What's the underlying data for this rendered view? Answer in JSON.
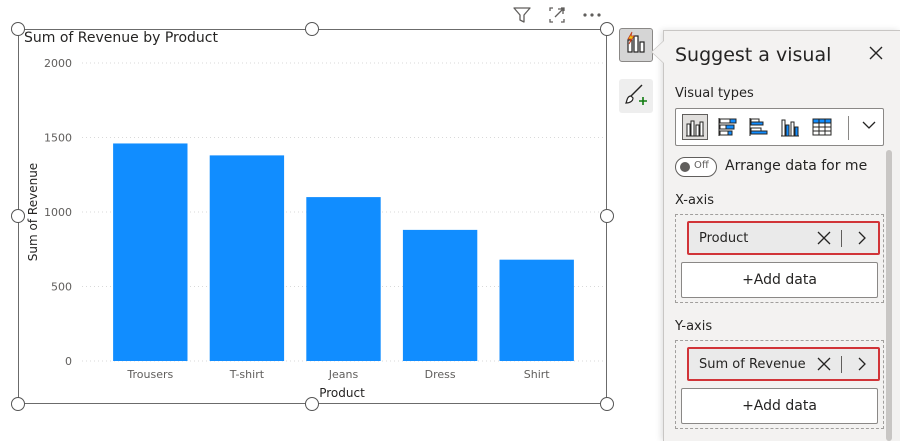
{
  "visual": {
    "header_icons": [
      "filter-icon",
      "focus-mode-icon",
      "more-options-icon"
    ]
  },
  "chart_data": {
    "type": "bar",
    "title": "Sum of Revenue by Product",
    "xlabel": "Product",
    "ylabel": "Sum of Revenue",
    "categories": [
      "Trousers",
      "T-shirt",
      "Jeans",
      "Dress",
      "Shirt"
    ],
    "values": [
      1460,
      1380,
      1100,
      880,
      680
    ],
    "ylim": [
      0,
      2000
    ],
    "yticks": [
      "0",
      "500",
      "1000",
      "1500",
      "2000"
    ],
    "bar_color": "#118dff",
    "grid": true
  },
  "ribbon": {
    "buttons": [
      "build-visual-icon",
      "format-visual-icon"
    ]
  },
  "pane": {
    "title": "Suggest a visual",
    "visual_types_label": "Visual types",
    "visual_type_icons": [
      "clustered-column-icon",
      "stacked-bar-icon",
      "clustered-bar-icon",
      "stacked-column-icon",
      "table-icon"
    ],
    "toggle_state": "Off",
    "toggle_label": "Arrange data for me",
    "x_axis": {
      "label": "X-axis",
      "field": "Product",
      "add_label": "+Add data"
    },
    "y_axis": {
      "label": "Y-axis",
      "field": "Sum of Revenue",
      "add_label": "+Add data"
    },
    "accent_color": "#d13438"
  }
}
